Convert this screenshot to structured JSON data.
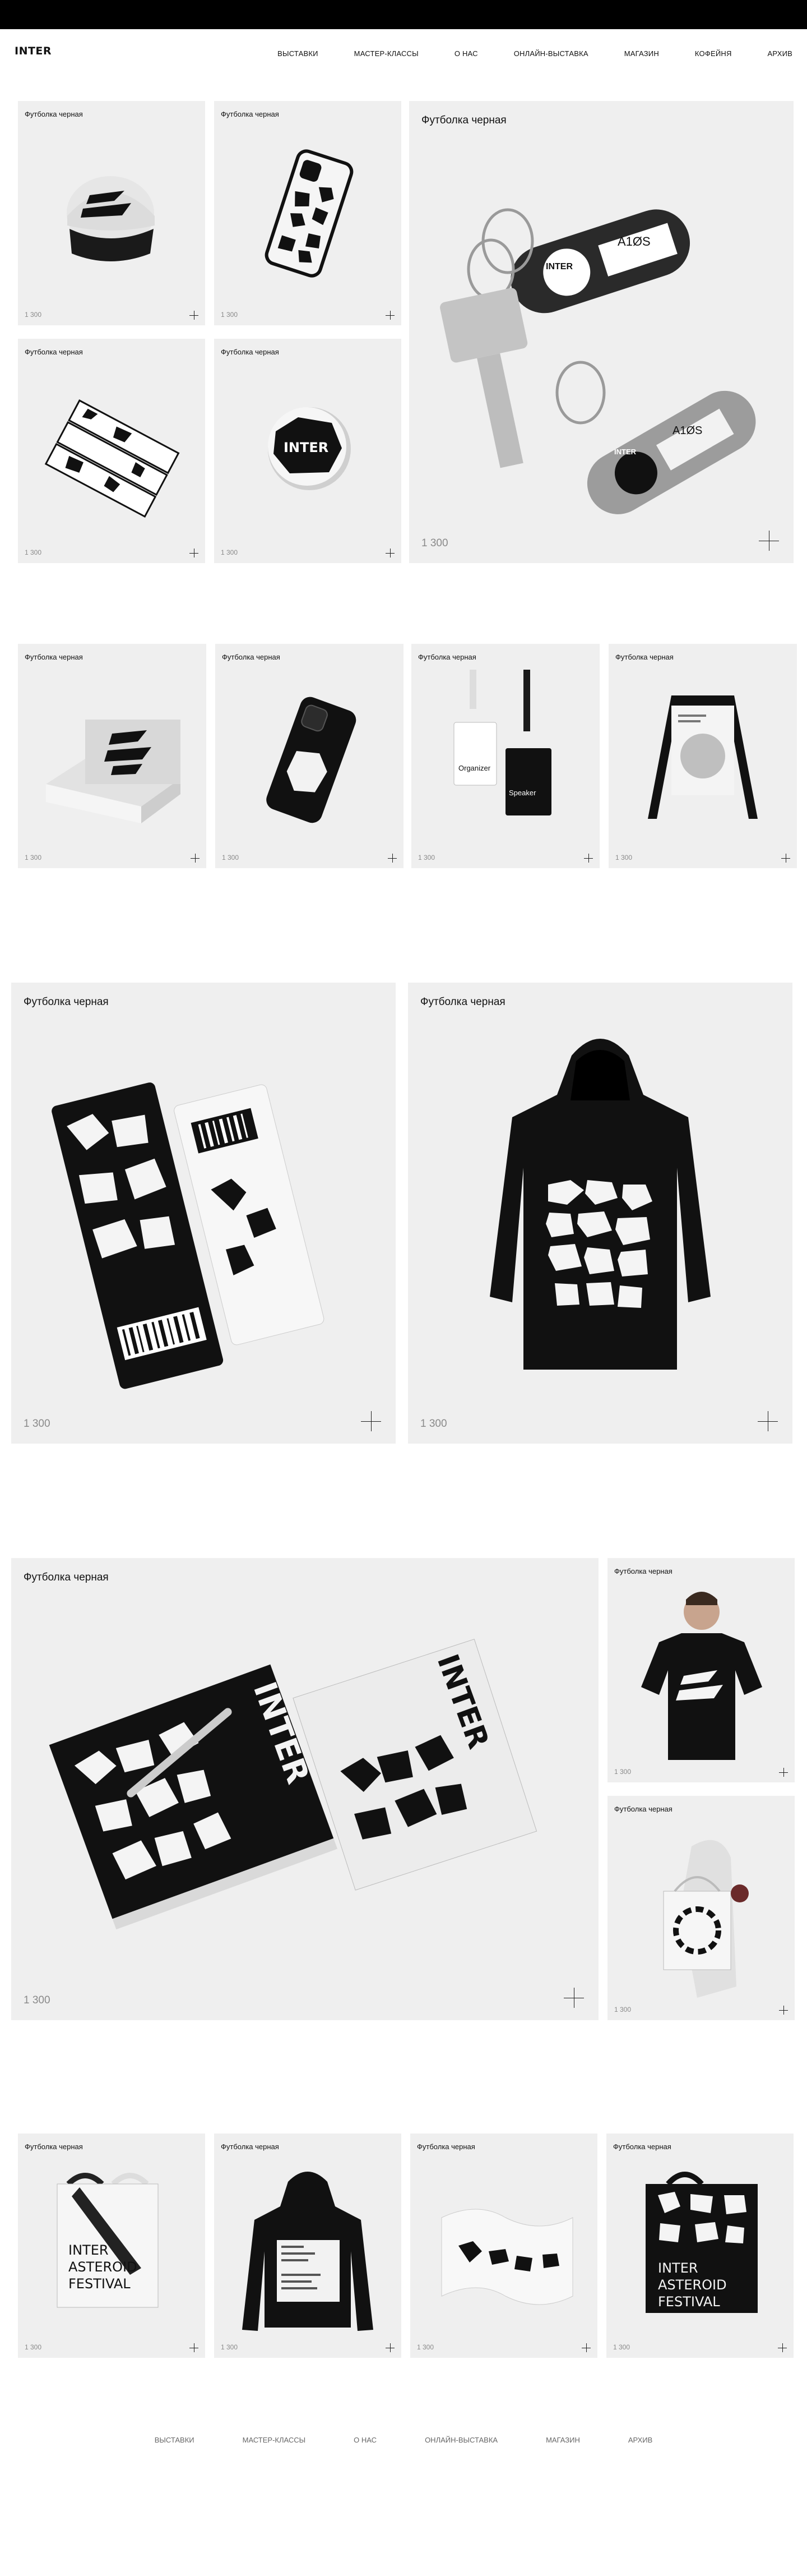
{
  "brand": {
    "logo": "INTER"
  },
  "nav": {
    "items": [
      "ВЫСТАВКИ",
      "МАСТЕР-КЛАССЫ",
      "О НАС",
      "ОНЛАЙН-ВЫСТАВКА",
      "МАГАЗИН",
      "КОФЕЙНЯ",
      "АРХИВ"
    ]
  },
  "products": {
    "cap": {
      "title": "Футболка черная",
      "price": "1 300"
    },
    "phone_case": {
      "title": "Футболка черная",
      "price": "1 300"
    },
    "keychain": {
      "title": "Футболка черная",
      "price": "1 300"
    },
    "cards": {
      "title": "Футболка черная",
      "price": "1 300"
    },
    "badge": {
      "title": "Футболка черная",
      "price": "1 300"
    },
    "box": {
      "title": "Футболка черная",
      "price": "1 300"
    },
    "phone_case_2": {
      "title": "Футболка черная",
      "price": "1 300"
    },
    "lanyards": {
      "title": "Футболка черная",
      "price": "1 300"
    },
    "stand": {
      "title": "Футболка черная",
      "price": "1 300"
    },
    "tickets": {
      "title": "Футболка черная",
      "price": "1 300"
    },
    "hoodie": {
      "title": "Футболка черная",
      "price": "1 300"
    },
    "notebooks": {
      "title": "Футболка черная",
      "price": "1 300"
    },
    "tshirt": {
      "title": "Футболка черная",
      "price": "1 300"
    },
    "tote_person": {
      "title": "Футболка черная",
      "price": "1 300"
    },
    "tote_white": {
      "title": "Футболка черная",
      "price": "1 300"
    },
    "hoodie_back": {
      "title": "Футболка черная",
      "price": "1 300"
    },
    "flag": {
      "title": "Футболка черная",
      "price": "1 300"
    },
    "tote_black": {
      "title": "Футболка черная",
      "price": "1 300"
    }
  },
  "art_text": {
    "inter": "INTER",
    "key_code": "A1ØS",
    "organizer": "Organizer",
    "speaker": "Speaker",
    "tote_line1": "INTER",
    "tote_line2": "ASTEROID",
    "tote_line3": "FESTIVAL"
  },
  "footer": {
    "items": [
      "ВЫСТАВКИ",
      "МАСТЕР-КЛАССЫ",
      "О НАС",
      "ОНЛАЙН-ВЫСТАВКА",
      "МАГАЗИН",
      "АРХИВ"
    ]
  },
  "colors": {
    "topbar": "#000000",
    "card_bg": "#efefef",
    "price": "#8a8a8a"
  }
}
